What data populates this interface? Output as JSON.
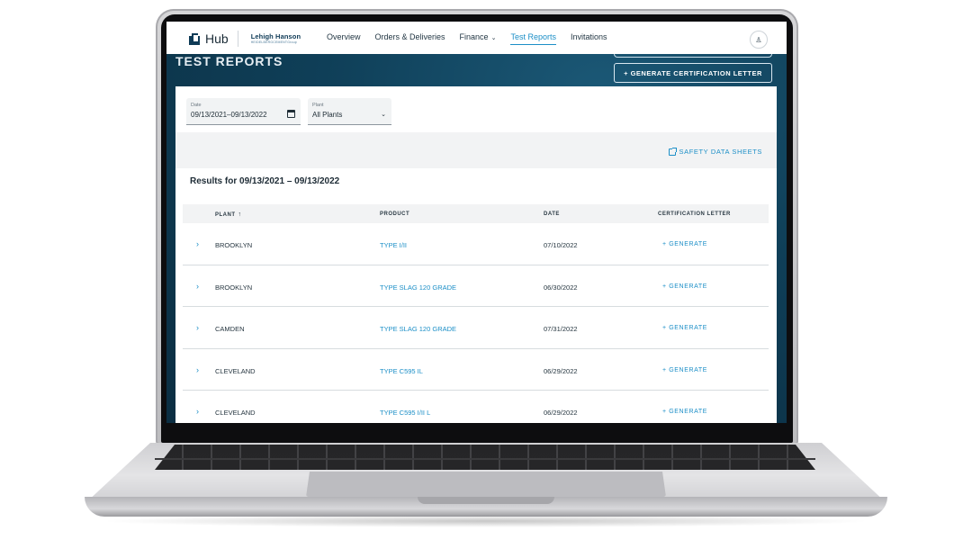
{
  "header": {
    "logo_text": "Hub",
    "brand_main": "Lehigh Hanson",
    "brand_sub": "HEIDELBERGCEMENTGroup",
    "nav": [
      {
        "label": "Overview"
      },
      {
        "label": "Orders & Deliveries"
      },
      {
        "label": "Finance"
      },
      {
        "label": "Test Reports"
      },
      {
        "label": "Invitations"
      }
    ],
    "active_nav": "Test Reports",
    "user_icon": "user-icon"
  },
  "page": {
    "title": "TEST REPORTS",
    "cert_button": "+ GENERATE CERTIFICATION LETTER"
  },
  "filters": {
    "date_label": "Date",
    "date_value": "09/13/2021–09/13/2022",
    "plant_label": "Plant",
    "plant_value": "All Plants"
  },
  "sds_link": "SAFETY DATA SHEETS",
  "results_title": "Results for 09/13/2021 – 09/13/2022",
  "table": {
    "columns": [
      "PLANT",
      "PRODUCT",
      "DATE",
      "CERTIFICATION LETTER"
    ],
    "sort_column": "PLANT",
    "sort_direction": "ascending",
    "rows": [
      {
        "plant": "BROOKLYN",
        "product": "TYPE I/II",
        "date": "07/10/2022",
        "action": "+ GENERATE"
      },
      {
        "plant": "BROOKLYN",
        "product": "TYPE SLAG 120 GRADE",
        "date": "06/30/2022",
        "action": "+ GENERATE"
      },
      {
        "plant": "CAMDEN",
        "product": "TYPE SLAG 120 GRADE",
        "date": "07/31/2022",
        "action": "+ GENERATE"
      },
      {
        "plant": "CLEVELAND",
        "product": "TYPE C595 IL",
        "date": "06/29/2022",
        "action": "+ GENERATE"
      },
      {
        "plant": "CLEVELAND",
        "product": "TYPE C595 I/II L",
        "date": "06/29/2022",
        "action": "+ GENERATE"
      }
    ]
  },
  "colors": {
    "accent": "#1c8fc7",
    "hero": "#0f3f58",
    "text": "#1f2d36"
  }
}
